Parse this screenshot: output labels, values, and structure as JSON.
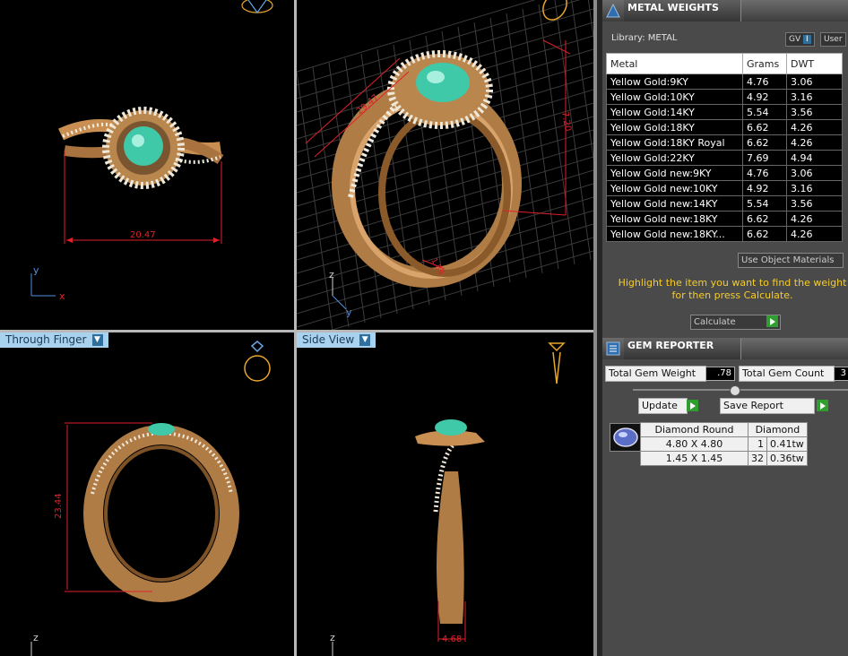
{
  "viewports": {
    "top_left": {
      "dimension": "20.47",
      "axis1": "y",
      "axis2": "x"
    },
    "top_right": {
      "dim_a": "29.47",
      "dim_b": "7.20",
      "dim_c": "1.88",
      "axis1": "z",
      "axis2": "y"
    },
    "bottom_left": {
      "label": "Through Finger",
      "dimension": "23.44",
      "axis1": "z"
    },
    "bottom_right": {
      "label": "Side View",
      "dimension": "4.68",
      "axis1": "z"
    }
  },
  "metal_weights": {
    "title": "METAL WEIGHTS",
    "library": "Library: METAL",
    "toggle_gv": "GV",
    "toggle_user": "User",
    "columns": [
      "Metal",
      "Grams",
      "DWT"
    ],
    "rows": [
      [
        "Yellow Gold:9KY",
        "4.76",
        "3.06"
      ],
      [
        "Yellow Gold:10KY",
        "4.92",
        "3.16"
      ],
      [
        "Yellow Gold:14KY",
        "5.54",
        "3.56"
      ],
      [
        "Yellow Gold:18KY",
        "6.62",
        "4.26"
      ],
      [
        "Yellow Gold:18KY Royal",
        "6.62",
        "4.26"
      ],
      [
        "Yellow Gold:22KY",
        "7.69",
        "4.94"
      ],
      [
        "Yellow Gold new:9KY",
        "4.76",
        "3.06"
      ],
      [
        "Yellow Gold new:10KY",
        "4.92",
        "3.16"
      ],
      [
        "Yellow Gold new:14KY",
        "5.54",
        "3.56"
      ],
      [
        "Yellow Gold new:18KY",
        "6.62",
        "4.26"
      ],
      [
        "Yellow Gold new:18KY...",
        "6.62",
        "4.26"
      ]
    ],
    "use_object_materials": "Use Object Materials",
    "hint": "Highlight the item you want to find the weight for then press Calculate.",
    "calculate": "Calculate"
  },
  "gem_reporter": {
    "title": "GEM REPORTER",
    "total_weight_label": "Total Gem Weight",
    "total_weight_value": ".78",
    "total_count_label": "Total Gem Count",
    "total_count_value": "3",
    "update": "Update",
    "save_report": "Save Report",
    "shape": "Diamond Round",
    "material": "Diamond",
    "rows": [
      {
        "size": "4.80 X 4.80",
        "count": "1",
        "weight": "0.41tw"
      },
      {
        "size": "1.45 X 1.45",
        "count": "32",
        "weight": "0.36tw"
      }
    ]
  },
  "colors": {
    "accent": "#f6cc29",
    "dimension": "#e0202a",
    "gold": "#c98f52",
    "gem": "#3fc9a8"
  }
}
